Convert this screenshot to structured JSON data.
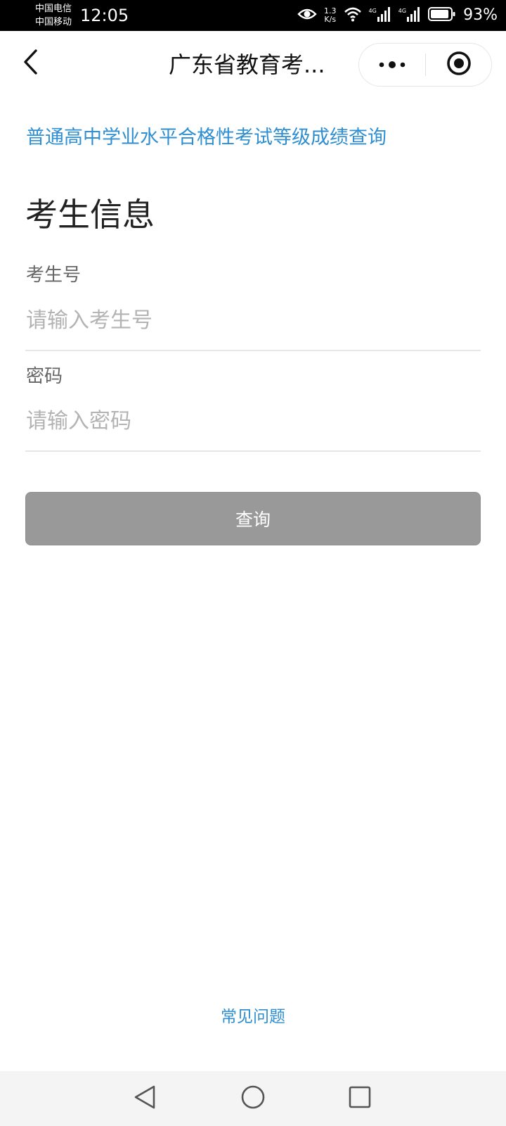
{
  "status_bar": {
    "carrier_1": "中国电信",
    "carrier_2": "中国移动",
    "time": "12:05",
    "net_speed_value": "1.3",
    "net_speed_unit": "K/s",
    "signal_tag_1": "4G",
    "signal_tag_2": "4G",
    "battery_percent": "93%",
    "battery_level": 0.93,
    "icons": [
      "eye-icon",
      "wifi-icon",
      "signal-icon",
      "signal-icon",
      "battery-icon"
    ]
  },
  "nav": {
    "title": "广东省教育考...",
    "back_icon": "chevron-left-icon",
    "more_icon": "more-dots-icon",
    "close_icon": "target-close-icon"
  },
  "main": {
    "heading": "普通高中学业水平合格性考试等级成绩查询",
    "section_title": "考生信息",
    "fields": [
      {
        "label": "考生号",
        "placeholder": "请输入考生号",
        "value": ""
      },
      {
        "label": "密码",
        "placeholder": "请输入密码",
        "value": ""
      }
    ],
    "submit_label": "查询",
    "faq_label": "常见问题"
  },
  "system_nav": {
    "icons": [
      "back-triangle-icon",
      "home-circle-icon",
      "recents-square-icon"
    ]
  },
  "colors": {
    "accent": "#2f8fd1",
    "button_disabled": "#999999",
    "placeholder": "#b3b3b3",
    "divider": "#e6e6e6"
  }
}
